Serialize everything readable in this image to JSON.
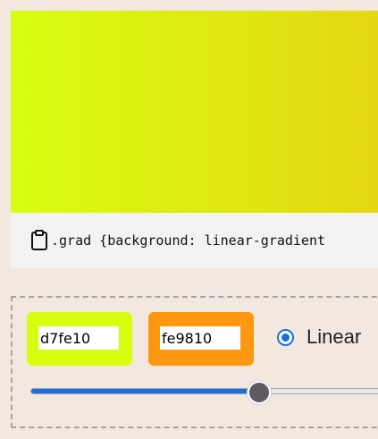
{
  "preview": {
    "color_start": "#d7fe10",
    "color_end": "#e4d811"
  },
  "code_bar": {
    "icon": "clipboard-icon",
    "text": ".grad {background: linear-gradient"
  },
  "controls": {
    "color1": {
      "value": "d7fe10",
      "swatch": "#d7fe10"
    },
    "color2": {
      "value": "fe9810",
      "swatch": "#fe9810"
    },
    "gradient_type": {
      "label": "Linear",
      "checked": true
    },
    "position_slider": {
      "value_percent": 64
    }
  }
}
